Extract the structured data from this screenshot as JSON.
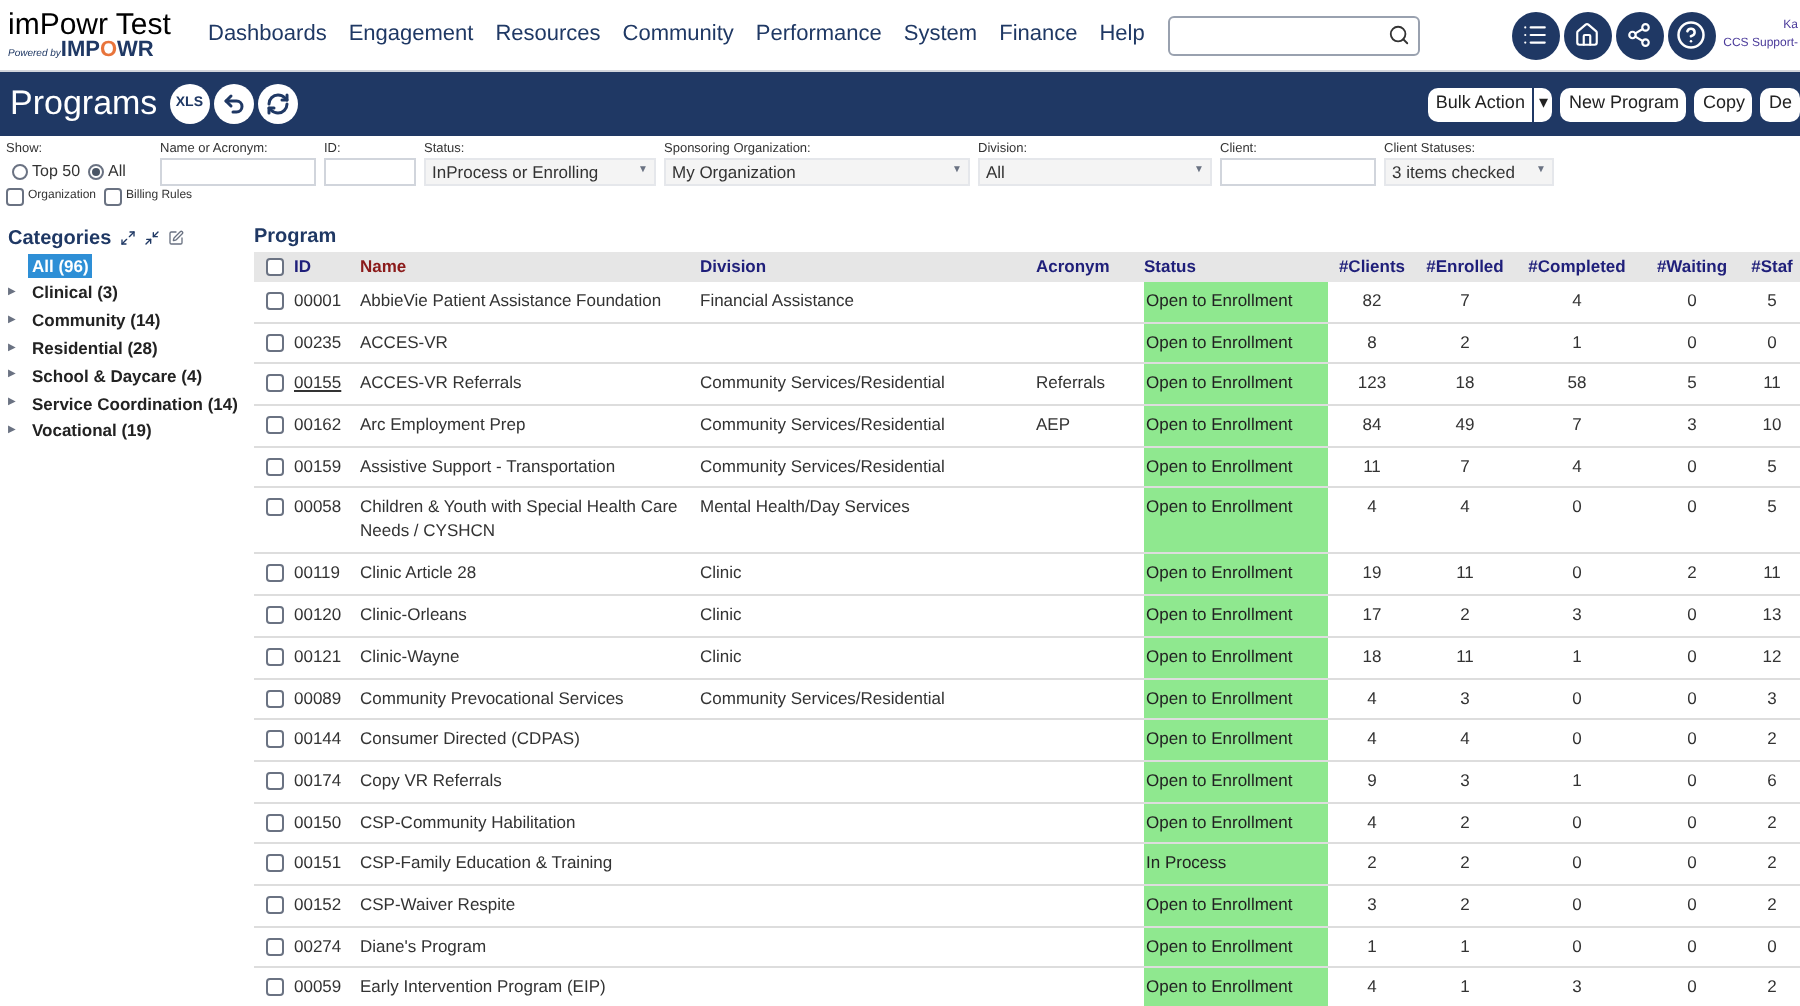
{
  "header": {
    "logo": {
      "title": "imPowr Test",
      "tagline": "Powered by",
      "brand": "IMPOWR"
    },
    "nav": [
      "Dashboards",
      "Engagement",
      "Resources",
      "Community",
      "Performance",
      "System",
      "Finance",
      "Help"
    ],
    "user": {
      "name": "Ka",
      "org": "CCS Support-"
    }
  },
  "page_bar": {
    "title": "Programs",
    "export_label": "XLS",
    "buttons": [
      {
        "label": "Bulk Action",
        "kind": "split",
        "caret": "▾"
      },
      {
        "label": "New Program",
        "kind": "plain"
      },
      {
        "label": "Copy",
        "kind": "plain"
      },
      {
        "label": "De",
        "kind": "plain"
      }
    ]
  },
  "filters": {
    "show": {
      "label": "Show:",
      "options": [
        {
          "label": "Top 50",
          "selected": false
        },
        {
          "label": "All",
          "selected": true
        }
      ]
    },
    "checkboxes": [
      {
        "label": "Organization",
        "checked": false
      },
      {
        "label": "Billing Rules",
        "checked": false
      }
    ],
    "fields": [
      {
        "label": "Name or Acronym:",
        "kind": "input"
      },
      {
        "label": "ID:",
        "kind": "input"
      },
      {
        "label": "Status:",
        "kind": "select",
        "value": "InProcess or Enrolling",
        "caret": "▼"
      },
      {
        "label": "Sponsoring Organization:",
        "kind": "select",
        "value": "My Organization",
        "caret": "▼"
      },
      {
        "label": "Division:",
        "kind": "select",
        "value": "All",
        "caret": "▼"
      },
      {
        "label": "Client:",
        "kind": "input"
      },
      {
        "label": "Client Statuses:",
        "kind": "select",
        "value": "3 items checked",
        "caret": "▼"
      }
    ]
  },
  "categories": {
    "title": "Categories",
    "items": [
      {
        "label": "All (96)",
        "selected": true
      },
      {
        "label": "Clinical (3)",
        "selected": false,
        "expand_icon": "▶"
      },
      {
        "label": "Community (14)",
        "selected": false,
        "expand_icon": "▶"
      },
      {
        "label": "Residential (28)",
        "selected": false,
        "expand_icon": "▶"
      },
      {
        "label": "School & Daycare (4)",
        "selected": false,
        "expand_icon": "▶"
      },
      {
        "label": "Service Coordination (14)",
        "selected": false,
        "expand_icon": "▶"
      },
      {
        "label": "Vocational (19)",
        "selected": false,
        "expand_icon": "▶"
      }
    ]
  },
  "table": {
    "title": "Program",
    "select_all_checked": false,
    "columns": [
      {
        "label": "ID",
        "sorted": false
      },
      {
        "label": "Name",
        "sorted": true
      },
      {
        "label": "Division",
        "sorted": false
      },
      {
        "label": "Acronym",
        "sorted": false
      },
      {
        "label": "Status",
        "sorted": false
      },
      {
        "label": "#Clients",
        "sorted": false
      },
      {
        "label": "#Enrolled",
        "sorted": false
      },
      {
        "label": "#Completed",
        "sorted": false
      },
      {
        "label": "#Waiting",
        "sorted": false
      },
      {
        "label": "#Staf",
        "sorted": false
      }
    ],
    "rows": [
      {
        "checked": false,
        "hovered": false,
        "cells": [
          "00001",
          "AbbieVie Patient Assistance Foundation",
          "Financial Assistance",
          "",
          "Open to Enrollment",
          "82",
          "7",
          "4",
          "0",
          "5"
        ]
      },
      {
        "checked": false,
        "hovered": false,
        "cells": [
          "00235",
          "ACCES-VR",
          "",
          "",
          "Open to Enrollment",
          "8",
          "2",
          "1",
          "0",
          "0"
        ]
      },
      {
        "checked": false,
        "hovered": true,
        "cells": [
          "00155",
          "ACCES-VR Referrals",
          "Community Services/Residential",
          "Referrals",
          "Open to Enrollment",
          "123",
          "18",
          "58",
          "5",
          "11"
        ]
      },
      {
        "checked": false,
        "hovered": false,
        "cells": [
          "00162",
          "Arc Employment Prep",
          "Community Services/Residential",
          "AEP",
          "Open to Enrollment",
          "84",
          "49",
          "7",
          "3",
          "10"
        ]
      },
      {
        "checked": false,
        "hovered": false,
        "cells": [
          "00159",
          "Assistive Support - Transportation",
          "Community Services/Residential",
          "",
          "Open to Enrollment",
          "11",
          "7",
          "4",
          "0",
          "5"
        ]
      },
      {
        "checked": false,
        "hovered": false,
        "cells": [
          "00058",
          "Children & Youth with Special Health Care Needs / CYSHCN",
          "Mental Health/Day Services",
          "",
          "Open to Enrollment",
          "4",
          "4",
          "0",
          "0",
          "5"
        ]
      },
      {
        "checked": false,
        "hovered": false,
        "cells": [
          "00119",
          "Clinic Article 28",
          "Clinic",
          "",
          "Open to Enrollment",
          "19",
          "11",
          "0",
          "2",
          "11"
        ]
      },
      {
        "checked": false,
        "hovered": false,
        "cells": [
          "00120",
          "Clinic-Orleans",
          "Clinic",
          "",
          "Open to Enrollment",
          "17",
          "2",
          "3",
          "0",
          "13"
        ]
      },
      {
        "checked": false,
        "hovered": false,
        "cells": [
          "00121",
          "Clinic-Wayne",
          "Clinic",
          "",
          "Open to Enrollment",
          "18",
          "11",
          "1",
          "0",
          "12"
        ]
      },
      {
        "checked": false,
        "hovered": false,
        "cells": [
          "00089",
          "Community Prevocational Services",
          "Community Services/Residential",
          "",
          "Open to Enrollment",
          "4",
          "3",
          "0",
          "0",
          "3"
        ]
      },
      {
        "checked": false,
        "hovered": false,
        "cells": [
          "00144",
          "Consumer Directed (CDPAS)",
          "",
          "",
          "Open to Enrollment",
          "4",
          "4",
          "0",
          "0",
          "2"
        ]
      },
      {
        "checked": false,
        "hovered": false,
        "cells": [
          "00174",
          "Copy VR Referrals",
          "",
          "",
          "Open to Enrollment",
          "9",
          "3",
          "1",
          "0",
          "6"
        ]
      },
      {
        "checked": false,
        "hovered": false,
        "cells": [
          "00150",
          "CSP-Community Habilitation",
          "",
          "",
          "Open to Enrollment",
          "4",
          "2",
          "0",
          "0",
          "2"
        ]
      },
      {
        "checked": false,
        "hovered": false,
        "cells": [
          "00151",
          "CSP-Family Education & Training",
          "",
          "",
          "In Process",
          "2",
          "2",
          "0",
          "0",
          "2"
        ]
      },
      {
        "checked": false,
        "hovered": false,
        "cells": [
          "00152",
          "CSP-Waiver Respite",
          "",
          "",
          "Open to Enrollment",
          "3",
          "2",
          "0",
          "0",
          "2"
        ]
      },
      {
        "checked": false,
        "hovered": false,
        "cells": [
          "00274",
          "Diane's Program",
          "",
          "",
          "Open to Enrollment",
          "1",
          "1",
          "0",
          "0",
          "0"
        ]
      },
      {
        "checked": false,
        "hovered": false,
        "cells": [
          "00059",
          "Early Intervention Program (EIP)",
          "",
          "",
          "Open to Enrollment",
          "4",
          "1",
          "3",
          "0",
          "2"
        ]
      }
    ]
  }
}
